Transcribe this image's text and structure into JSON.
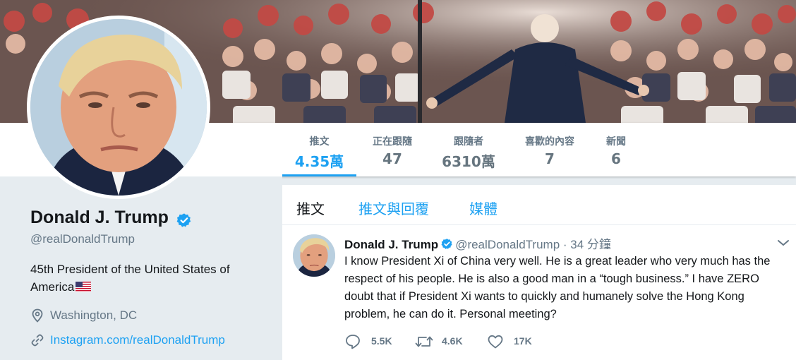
{
  "profile": {
    "name": "Donald J. Trump",
    "handle": "@realDonaldTrump",
    "bio": "45th President of the United States of America",
    "location": "Washington, DC",
    "link": "Instagram.com/realDonaldTrump"
  },
  "nav": {
    "items": [
      {
        "label": "推文",
        "value": "4.35萬"
      },
      {
        "label": "正在跟隨",
        "value": "47"
      },
      {
        "label": "跟隨者",
        "value": "6310萬"
      },
      {
        "label": "喜歡的內容",
        "value": "7"
      },
      {
        "label": "新聞",
        "value": "6"
      }
    ]
  },
  "tabs": {
    "tweets": "推文",
    "replies": "推文與回覆",
    "media": "媒體"
  },
  "tweet": {
    "name": "Donald J. Trump",
    "handle": "@realDonaldTrump",
    "time": "· 34 分鐘",
    "text": "I know President Xi of China very well. He is a great leader who very much has the respect of his people. He is also a good man in a “tough business.” I have ZERO doubt that if President Xi wants to quickly and humanely solve the Hong Kong problem, he can do it. Personal meeting?",
    "replies": "5.5K",
    "retweets": "4.6K",
    "likes": "17K"
  },
  "icons": {
    "verified": "verified-badge-icon",
    "location": "location-pin-icon",
    "link": "link-icon",
    "reply": "reply-icon",
    "retweet": "retweet-icon",
    "like": "heart-icon",
    "caret": "chevron-down-icon"
  },
  "colors": {
    "accent": "#1da1f2",
    "muted": "#657786",
    "background": "#e6ecf0"
  }
}
